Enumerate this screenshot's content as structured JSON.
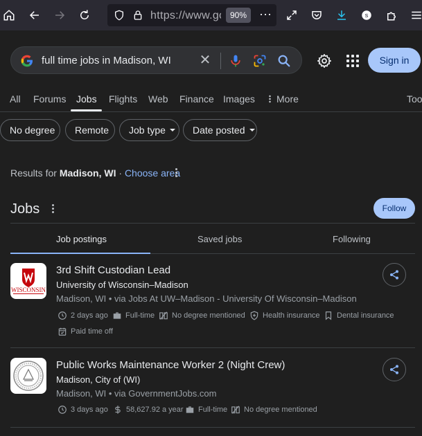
{
  "browser": {
    "url": "https://www.google.com",
    "zoom": "90%"
  },
  "search": {
    "query": "full time jobs in Madison, WI",
    "sign_in": "Sign in"
  },
  "tabs": [
    {
      "label": "All"
    },
    {
      "label": "Forums"
    },
    {
      "label": "Jobs"
    },
    {
      "label": "Flights"
    },
    {
      "label": "Web"
    },
    {
      "label": "Finance"
    },
    {
      "label": "Images"
    },
    {
      "label": "More"
    },
    {
      "label": "Too"
    }
  ],
  "filters": [
    {
      "label": "No degree"
    },
    {
      "label": "Remote"
    },
    {
      "label": "Job type"
    },
    {
      "label": "Date posted"
    }
  ],
  "results_for": {
    "prefix": "Results for ",
    "location": "Madison, WI",
    "separator": " · ",
    "choose_area": "Choose area"
  },
  "jobs_section": {
    "title": "Jobs",
    "follow": "Follow",
    "subtabs": [
      {
        "label": "Job postings"
      },
      {
        "label": "Saved jobs"
      },
      {
        "label": "Following"
      }
    ]
  },
  "jobs": [
    {
      "title": "3rd Shift Custodian Lead",
      "company": "University of Wisconsin–Madison",
      "location_via": "Madison, WI • via Jobs At UW–Madison - University Of Wisconsin–Madison",
      "logo_text": "WISCONSIN",
      "meta": [
        {
          "icon": "clock-icon",
          "text": "2 days ago"
        },
        {
          "icon": "briefcase-icon",
          "text": "Full-time"
        },
        {
          "icon": "degree-icon",
          "text": "No degree mentioned"
        },
        {
          "icon": "health-icon",
          "text": "Health insurance"
        },
        {
          "icon": "tooth-icon",
          "text": "Dental insurance"
        },
        {
          "icon": "calendar-icon",
          "text": "Paid time off"
        }
      ]
    },
    {
      "title": "Public Works Maintenance Worker 2 (Night Crew)",
      "company": "Madison, City of (WI)",
      "location_via": "Madison, WI • via GovernmentJobs.com",
      "meta": [
        {
          "icon": "clock-icon",
          "text": "3 days ago"
        },
        {
          "icon": "dollar-icon",
          "text": "58,627.92 a year"
        },
        {
          "icon": "briefcase-icon",
          "text": "Full-time"
        },
        {
          "icon": "degree-icon",
          "text": "No degree mentioned"
        }
      ]
    }
  ],
  "colors": {
    "background": "#1f1f1f",
    "accent_button": "#a8c7fa",
    "link": "#8ab4f8"
  }
}
